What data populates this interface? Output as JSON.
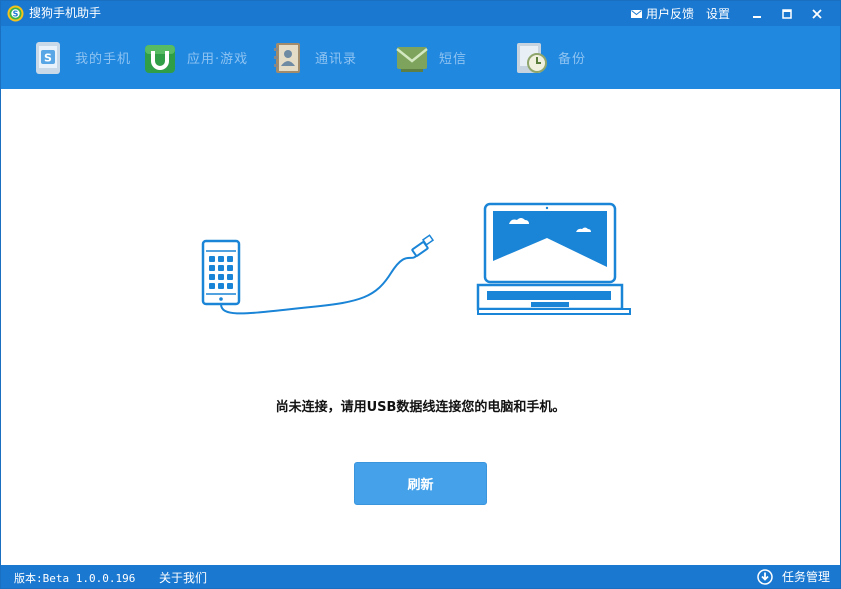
{
  "titlebar": {
    "app_title": "搜狗手机助手",
    "feedback": "用户反馈",
    "settings": "设置"
  },
  "nav": [
    {
      "label": "我的手机",
      "icon": "phone-s-icon"
    },
    {
      "label": "应用·游戏",
      "icon": "apps-u-icon"
    },
    {
      "label": "通讯录",
      "icon": "contacts-icon"
    },
    {
      "label": "短信",
      "icon": "sms-icon"
    },
    {
      "label": "备份",
      "icon": "backup-icon"
    }
  ],
  "main": {
    "message": "尚未连接，请用USB数据线连接您的电脑和手机。",
    "refresh_label": "刷新"
  },
  "status": {
    "version": "版本:Beta 1.0.0.196",
    "about": "关于我们",
    "task_manager": "任务管理"
  },
  "colors": {
    "titlebar": "#1b78d0",
    "toolbar": "#2188e0",
    "illustration": "#1a84d6",
    "button": "#45a2ea"
  }
}
